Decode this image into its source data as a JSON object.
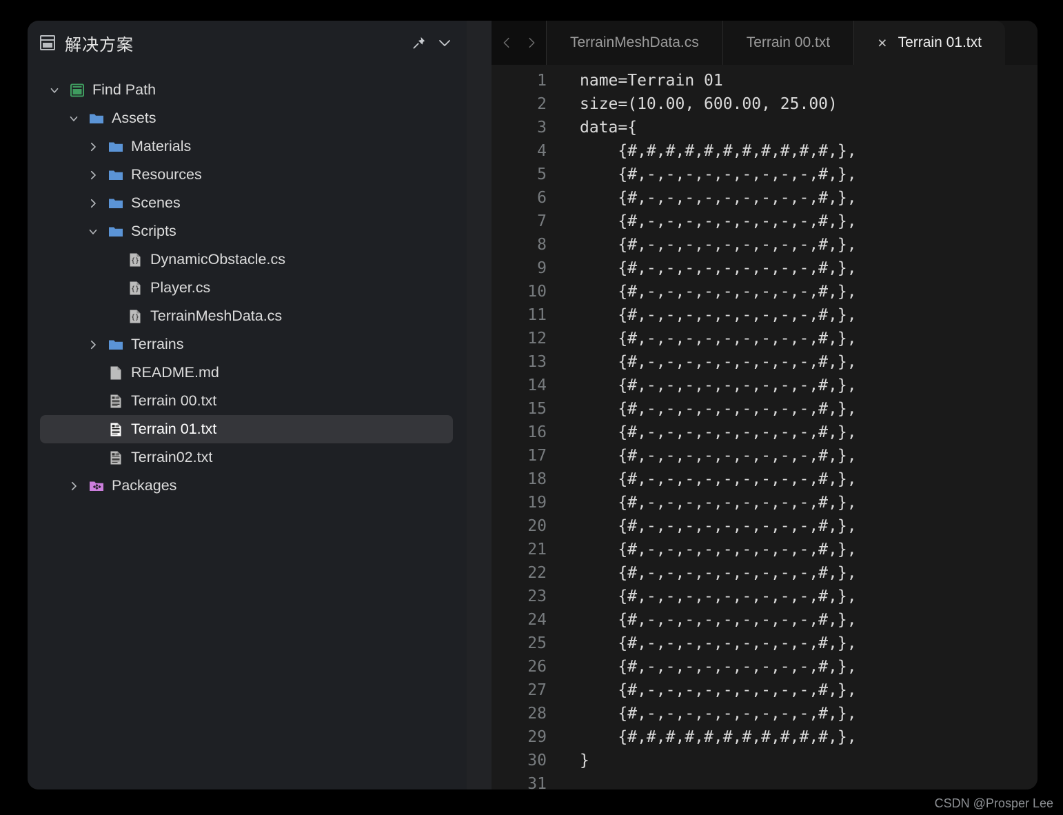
{
  "window": {
    "background": "#1a1a1a",
    "page_background": "#000000"
  },
  "sidebar": {
    "header": {
      "icon": "solution-icon",
      "title": "解决方案",
      "pin_icon": "pin-icon",
      "chevron_icon": "chevron-down-icon"
    },
    "tree": [
      {
        "label": "Find Path",
        "depth": 0,
        "icon": "solution-green-icon",
        "twisty": "down",
        "selected": false
      },
      {
        "label": "Assets",
        "depth": 1,
        "icon": "folder-icon",
        "twisty": "down",
        "selected": false
      },
      {
        "label": "Materials",
        "depth": 2,
        "icon": "folder-icon",
        "twisty": "right",
        "selected": false
      },
      {
        "label": "Resources",
        "depth": 2,
        "icon": "folder-icon",
        "twisty": "right",
        "selected": false
      },
      {
        "label": "Scenes",
        "depth": 2,
        "icon": "folder-icon",
        "twisty": "right",
        "selected": false
      },
      {
        "label": "Scripts",
        "depth": 2,
        "icon": "folder-icon",
        "twisty": "down",
        "selected": false
      },
      {
        "label": "DynamicObstacle.cs",
        "depth": 3,
        "icon": "csharp-file-icon",
        "twisty": "none",
        "selected": false
      },
      {
        "label": "Player.cs",
        "depth": 3,
        "icon": "csharp-file-icon",
        "twisty": "none",
        "selected": false
      },
      {
        "label": "TerrainMeshData.cs",
        "depth": 3,
        "icon": "csharp-file-icon",
        "twisty": "none",
        "selected": false
      },
      {
        "label": "Terrains",
        "depth": 2,
        "icon": "folder-icon",
        "twisty": "right",
        "selected": false
      },
      {
        "label": "README.md",
        "depth": 2,
        "icon": "plain-file-icon",
        "twisty": "none",
        "selected": false
      },
      {
        "label": "Terrain 00.txt",
        "depth": 2,
        "icon": "text-file-icon",
        "twisty": "none",
        "selected": false
      },
      {
        "label": "Terrain 01.txt",
        "depth": 2,
        "icon": "text-file-icon",
        "twisty": "none",
        "selected": true
      },
      {
        "label": "Terrain02.txt",
        "depth": 2,
        "icon": "text-file-icon",
        "twisty": "none",
        "selected": false
      },
      {
        "label": "Packages",
        "depth": 1,
        "icon": "package-icon",
        "twisty": "right",
        "selected": false
      }
    ]
  },
  "tabbar": {
    "nav_back_icon": "chevron-left-icon",
    "nav_forward_icon": "chevron-right-icon",
    "tabs": [
      {
        "label": "TerrainMeshData.cs",
        "active": false,
        "closable": false
      },
      {
        "label": "Terrain 00.txt",
        "active": false,
        "closable": false
      },
      {
        "label": "Terrain 01.txt",
        "active": true,
        "closable": true,
        "close_glyph": "×"
      }
    ]
  },
  "editor": {
    "first_line_number": 1,
    "last_line_number": 31,
    "lines": [
      "name=Terrain 01",
      "size=(10.00, 600.00, 25.00)",
      "data={",
      "    {#,#,#,#,#,#,#,#,#,#,#,},",
      "    {#,-,-,-,-,-,-,-,-,-,#,},",
      "    {#,-,-,-,-,-,-,-,-,-,#,},",
      "    {#,-,-,-,-,-,-,-,-,-,#,},",
      "    {#,-,-,-,-,-,-,-,-,-,#,},",
      "    {#,-,-,-,-,-,-,-,-,-,#,},",
      "    {#,-,-,-,-,-,-,-,-,-,#,},",
      "    {#,-,-,-,-,-,-,-,-,-,#,},",
      "    {#,-,-,-,-,-,-,-,-,-,#,},",
      "    {#,-,-,-,-,-,-,-,-,-,#,},",
      "    {#,-,-,-,-,-,-,-,-,-,#,},",
      "    {#,-,-,-,-,-,-,-,-,-,#,},",
      "    {#,-,-,-,-,-,-,-,-,-,#,},",
      "    {#,-,-,-,-,-,-,-,-,-,#,},",
      "    {#,-,-,-,-,-,-,-,-,-,#,},",
      "    {#,-,-,-,-,-,-,-,-,-,#,},",
      "    {#,-,-,-,-,-,-,-,-,-,#,},",
      "    {#,-,-,-,-,-,-,-,-,-,#,},",
      "    {#,-,-,-,-,-,-,-,-,-,#,},",
      "    {#,-,-,-,-,-,-,-,-,-,#,},",
      "    {#,-,-,-,-,-,-,-,-,-,#,},",
      "    {#,-,-,-,-,-,-,-,-,-,#,},",
      "    {#,-,-,-,-,-,-,-,-,-,#,},",
      "    {#,-,-,-,-,-,-,-,-,-,#,},",
      "    {#,-,-,-,-,-,-,-,-,-,#,},",
      "    {#,#,#,#,#,#,#,#,#,#,#,},",
      "}",
      ""
    ]
  },
  "watermark": {
    "text": "CSDN @Prosper Lee"
  },
  "colors": {
    "folder_blue": "#5b94d6",
    "solution_green": "#3f9c5f",
    "package_purple": "#cc7fdd",
    "file_grey": "#bcbcbc",
    "selection": "#35363a",
    "sidebar_bg": "#1e2024",
    "editor_bg": "#1a1a1a",
    "tabbar_bg": "#141414"
  }
}
